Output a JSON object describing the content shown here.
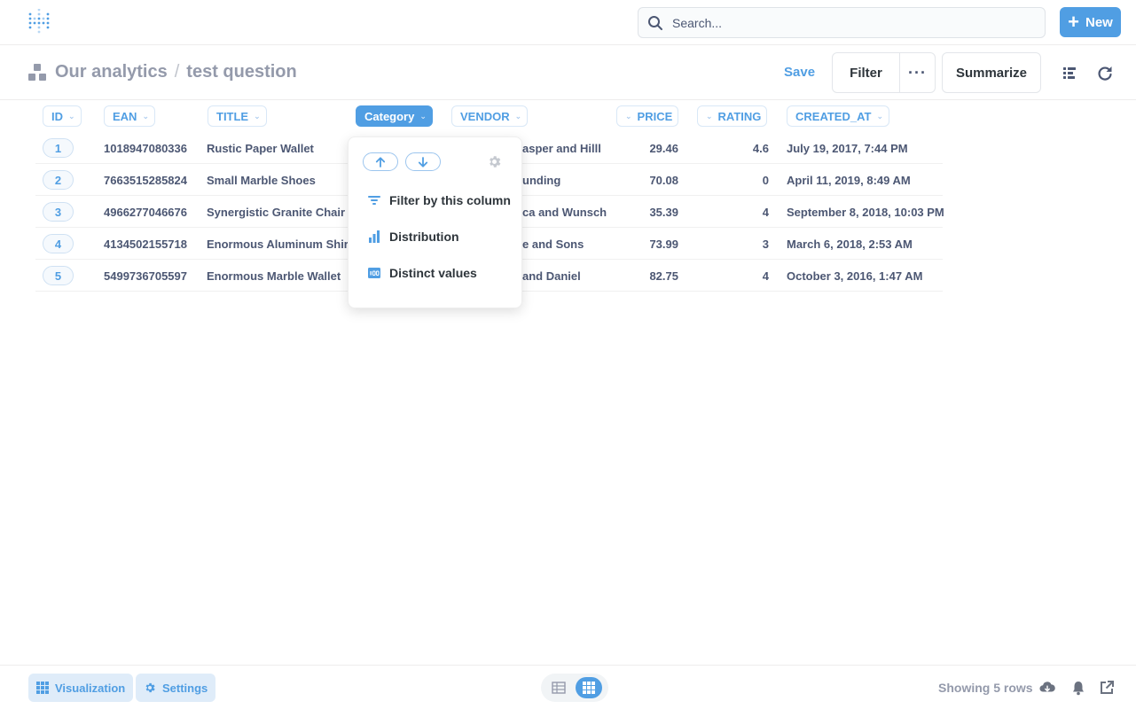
{
  "colors": {
    "brand": "#509ee3",
    "text_dark": "#2e353b",
    "text_medium": "#4c5773",
    "text_light": "#949aab"
  },
  "nav": {
    "search_placeholder": "Search...",
    "new_label": "New"
  },
  "header": {
    "collection": "Our analytics",
    "separator": "/",
    "question": "test question",
    "save_label": "Save",
    "filter_label": "Filter",
    "more_label": "···",
    "summarize_label": "Summarize"
  },
  "table": {
    "columns": [
      "ID",
      "EAN",
      "TITLE",
      "Category",
      "VENDOR",
      "PRICE",
      "RATING",
      "CREATED_AT"
    ],
    "rows": [
      {
        "id": "1",
        "ean": "1018947080336",
        "title": "Rustic Paper Wallet",
        "vendor": "asper and Hilll",
        "price": "29.46",
        "rating": "4.6",
        "created_at": "July 19, 2017, 7:44 PM"
      },
      {
        "id": "2",
        "ean": "7663515285824",
        "title": "Small Marble Shoes",
        "vendor": "unding",
        "price": "70.08",
        "rating": "0",
        "created_at": "April 11, 2019, 8:49 AM"
      },
      {
        "id": "3",
        "ean": "4966277046676",
        "title": "Synergistic Granite Chair",
        "vendor": "ca and Wunsch",
        "price": "35.39",
        "rating": "4",
        "created_at": "September 8, 2018, 10:03 PM"
      },
      {
        "id": "4",
        "ean": "4134502155718",
        "title": "Enormous Aluminum Shirt",
        "vendor": "e and Sons",
        "price": "73.99",
        "rating": "3",
        "created_at": "March 6, 2018, 2:53 AM"
      },
      {
        "id": "5",
        "ean": "5499736705597",
        "title": "Enormous Marble Wallet",
        "vendor": "and Daniel",
        "price": "82.75",
        "rating": "4",
        "created_at": "October 3, 2016, 1:47 AM"
      }
    ]
  },
  "popover": {
    "items": [
      "Filter by this column",
      "Distribution",
      "Distinct values"
    ]
  },
  "footer": {
    "visualization_label": "Visualization",
    "settings_label": "Settings",
    "row_count": "Showing 5 rows"
  }
}
